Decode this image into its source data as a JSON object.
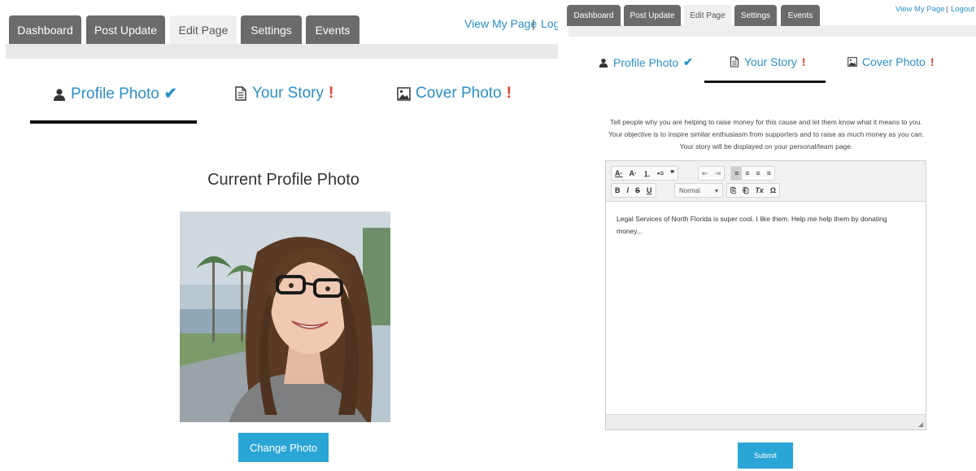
{
  "left": {
    "tabs": [
      {
        "label": "Dashboard"
      },
      {
        "label": "Post Update"
      },
      {
        "label": "Edit Page"
      },
      {
        "label": "Settings"
      },
      {
        "label": "Events"
      }
    ],
    "links": {
      "view_my_page": "View My Page",
      "separator": "|",
      "logout": "Log"
    },
    "steps": [
      {
        "label": "Profile Photo",
        "status": "done"
      },
      {
        "label": "Your Story",
        "status": "missing"
      },
      {
        "label": "Cover Photo",
        "status": "missing"
      }
    ],
    "section_title": "Current Profile Photo",
    "change_photo_label": "Change Photo"
  },
  "right": {
    "tabs": [
      {
        "label": "Dashboard"
      },
      {
        "label": "Post Update"
      },
      {
        "label": "Edit Page"
      },
      {
        "label": "Settings"
      },
      {
        "label": "Events"
      }
    ],
    "links": {
      "view_my_page": "View My Page",
      "separator": "|",
      "logout": "Logout"
    },
    "steps": [
      {
        "label": "Profile Photo",
        "status": "done"
      },
      {
        "label": "Your Story",
        "status": "missing"
      },
      {
        "label": "Cover Photo",
        "status": "missing"
      }
    ],
    "intro": [
      "Tell people why you are helping to raise money for this cause and let them know what it means to you.",
      "Your objective is to inspire similar enthusiasm from supporters and to raise as much money as you can.",
      "Your story will be displayed on your personal/team page."
    ],
    "editor": {
      "format_value": "Normal",
      "content": "Legal Services of North Florida is super cool. I like them. Help me help them by donating money..."
    },
    "submit_label": "Submit"
  },
  "glyphs": {
    "check": "✔",
    "bang": "!",
    "text_color": "A·",
    "bg_color": "A·",
    "ordered_list": "⒈",
    "bullet_list": "•≡",
    "blockquote": "❞",
    "outdent": "⇤",
    "indent": "⇥",
    "align_left": "≡",
    "align_center": "≡",
    "align_right": "≡",
    "align_justify": "≡",
    "bold": "B",
    "italic": "I",
    "strike": "S",
    "underline": "U",
    "paste_text": "⎘",
    "paste_word": "⎗",
    "remove_format": "Tx",
    "special_char": "Ω",
    "dropdown_caret": "▾"
  },
  "colors": {
    "accent_blue": "#2a8fc9",
    "button_blue": "#2aa6d6",
    "alert_red": "#e23b2e",
    "tab_dark": "#6b6b6b"
  }
}
